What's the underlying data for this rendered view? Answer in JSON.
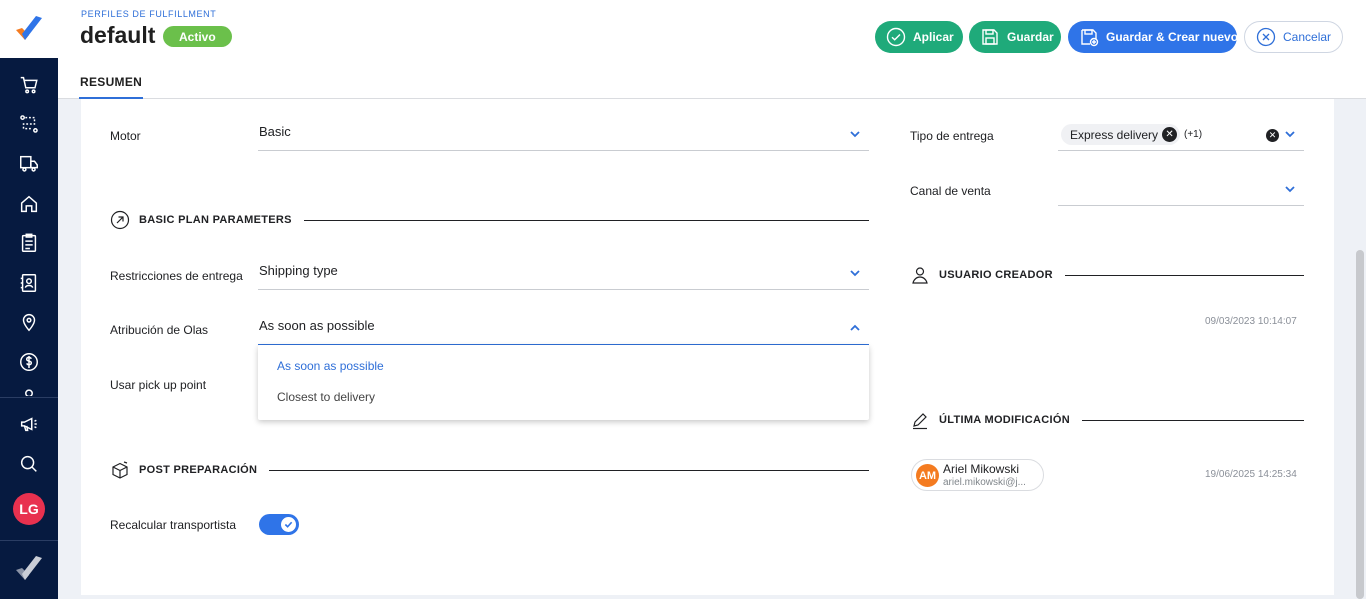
{
  "header": {
    "breadcrumb": "PERFILES DE FULFILLMENT",
    "title": "default",
    "status": "Activo",
    "buttons": {
      "apply": "Aplicar",
      "save": "Guardar",
      "save_new": "Guardar & Crear nuevo",
      "cancel": "Cancelar"
    },
    "tabs": [
      {
        "label": "RESUMEN",
        "active": true
      }
    ]
  },
  "sidebar": {
    "items": [
      {
        "icon": "cart-icon"
      },
      {
        "icon": "route-icon"
      },
      {
        "icon": "truck-icon"
      },
      {
        "icon": "home-icon"
      },
      {
        "icon": "clipboard-icon"
      },
      {
        "icon": "contacts-icon"
      },
      {
        "icon": "location-pin-icon"
      },
      {
        "icon": "dollar-icon"
      },
      {
        "icon": "megaphone-icon"
      },
      {
        "icon": "search-icon"
      }
    ],
    "avatar_initials": "LG"
  },
  "form": {
    "motor": {
      "label": "Motor",
      "value": "Basic"
    },
    "basic_plan_title": "BASIC PLAN PARAMETERS",
    "restricciones": {
      "label": "Restricciones de entrega",
      "value": "Shipping type"
    },
    "atribucion": {
      "label": "Atribución de Olas",
      "value": "As soon as possible"
    },
    "dropdown_options": [
      "As soon as possible",
      "Closest to delivery"
    ],
    "pickup": {
      "label": "Usar pick up point"
    },
    "post_prep_title": "POST PREPARACIÓN",
    "recalcular": {
      "label": "Recalcular transportista",
      "enabled": true
    },
    "tipo_entrega": {
      "label": "Tipo de entrega",
      "chip": "Express delivery",
      "more": "(+1)"
    },
    "canal_venta": {
      "label": "Canal de venta",
      "value": ""
    }
  },
  "audit": {
    "creator_title": "USUARIO CREADOR",
    "created_date": "09/03/2023 10:14:07",
    "modified_title": "ÚLTIMA MODIFICACIÓN",
    "modified_user": {
      "initials": "AM",
      "name": "Ariel Mikowski",
      "email": "ariel.mikowski@j..."
    },
    "modified_date": "19/06/2025 14:25:34"
  },
  "colors": {
    "sidebar": "#061a40",
    "primary": "#2f74e8",
    "success": "#1faa7a",
    "badge": "#6bc04b",
    "avatar_lg": "#e8314f",
    "avatar_am": "#f47b20"
  }
}
